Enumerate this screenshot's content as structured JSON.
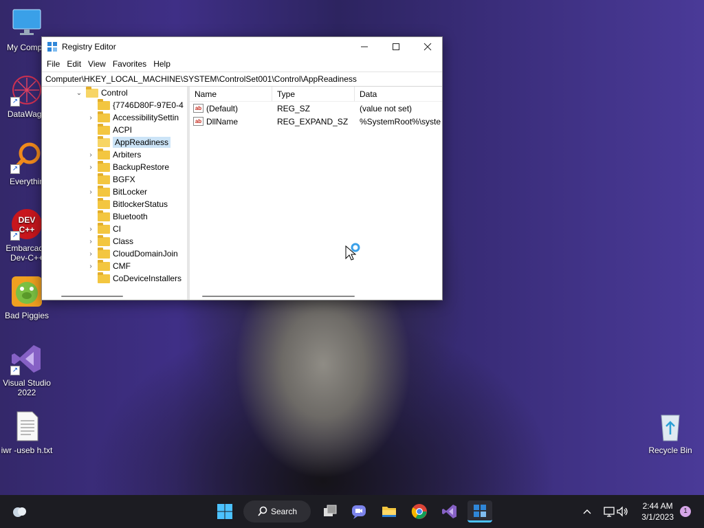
{
  "desktop": {
    "icons": [
      {
        "label": "My Compu",
        "icon": "monitor-icon"
      },
      {
        "label": "DataWago",
        "icon": "datawagon-icon"
      },
      {
        "label": "Everythin",
        "icon": "search-magnifier-icon"
      },
      {
        "label": "Embarcade Dev-C++",
        "icon": "devcpp-icon"
      },
      {
        "label": "Bad Piggies",
        "icon": "bad-piggies-icon"
      },
      {
        "label": "Visual Studio 2022",
        "icon": "visual-studio-icon"
      },
      {
        "label": "iwr -useb h.txt",
        "icon": "text-file-icon"
      },
      {
        "label": "Recycle Bin",
        "icon": "recycle-bin-icon"
      }
    ]
  },
  "window": {
    "title": "Registry Editor",
    "menu": [
      "File",
      "Edit",
      "View",
      "Favorites",
      "Help"
    ],
    "address": "Computer\\HKEY_LOCAL_MACHINE\\SYSTEM\\ControlSet001\\Control\\AppReadiness",
    "tree": [
      {
        "label": "Control",
        "expanded": true
      },
      {
        "label": "{7746D80F-97E0-4",
        "expandable": false
      },
      {
        "label": "AccessibilitySettin",
        "expandable": true
      },
      {
        "label": "ACPI",
        "expandable": false
      },
      {
        "label": "AppReadiness",
        "selected": true
      },
      {
        "label": "Arbiters",
        "expandable": true
      },
      {
        "label": "BackupRestore",
        "expandable": true
      },
      {
        "label": "BGFX",
        "expandable": false
      },
      {
        "label": "BitLocker",
        "expandable": true
      },
      {
        "label": "BitlockerStatus",
        "expandable": false
      },
      {
        "label": "Bluetooth",
        "expandable": false
      },
      {
        "label": "CI",
        "expandable": true
      },
      {
        "label": "Class",
        "expandable": true
      },
      {
        "label": "CloudDomainJoin",
        "expandable": true
      },
      {
        "label": "CMF",
        "expandable": true
      },
      {
        "label": "CoDeviceInstallers",
        "expandable": false
      }
    ],
    "columns": {
      "name": "Name",
      "type": "Type",
      "data": "Data"
    },
    "values": [
      {
        "name": "(Default)",
        "type": "REG_SZ",
        "data": "(value not set)"
      },
      {
        "name": "DllName",
        "type": "REG_EXPAND_SZ",
        "data": "%SystemRoot%\\syste"
      }
    ]
  },
  "taskbar": {
    "search_label": "Search",
    "time": "2:44 AM",
    "date": "3/1/2023",
    "notification_count": "1"
  }
}
